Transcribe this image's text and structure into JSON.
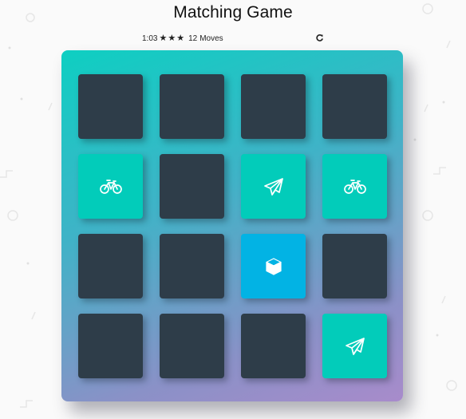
{
  "header": {
    "title": "Matching Game"
  },
  "score_panel": {
    "timer": "1:03",
    "stars": [
      "star-icon",
      "star-icon",
      "star-icon"
    ],
    "moves_count": "12",
    "moves_label": "Moves",
    "restart_icon": "restart-icon"
  },
  "colors": {
    "closed": "#2e3d49",
    "match": "#02ccba",
    "open": "#02b3e4",
    "deck_gradient_start": "#0ecfc2",
    "deck_gradient_end": "#a88bcb"
  },
  "deck": {
    "cards": [
      {
        "state": "closed",
        "icon": ""
      },
      {
        "state": "closed",
        "icon": ""
      },
      {
        "state": "closed",
        "icon": ""
      },
      {
        "state": "closed",
        "icon": ""
      },
      {
        "state": "match",
        "icon": "bicycle-icon"
      },
      {
        "state": "closed",
        "icon": ""
      },
      {
        "state": "match",
        "icon": "paper-plane-icon"
      },
      {
        "state": "match",
        "icon": "bicycle-icon"
      },
      {
        "state": "closed",
        "icon": ""
      },
      {
        "state": "closed",
        "icon": ""
      },
      {
        "state": "open",
        "icon": "cube-icon"
      },
      {
        "state": "closed",
        "icon": ""
      },
      {
        "state": "closed",
        "icon": ""
      },
      {
        "state": "closed",
        "icon": ""
      },
      {
        "state": "closed",
        "icon": ""
      },
      {
        "state": "match",
        "icon": "paper-plane-icon"
      }
    ]
  }
}
